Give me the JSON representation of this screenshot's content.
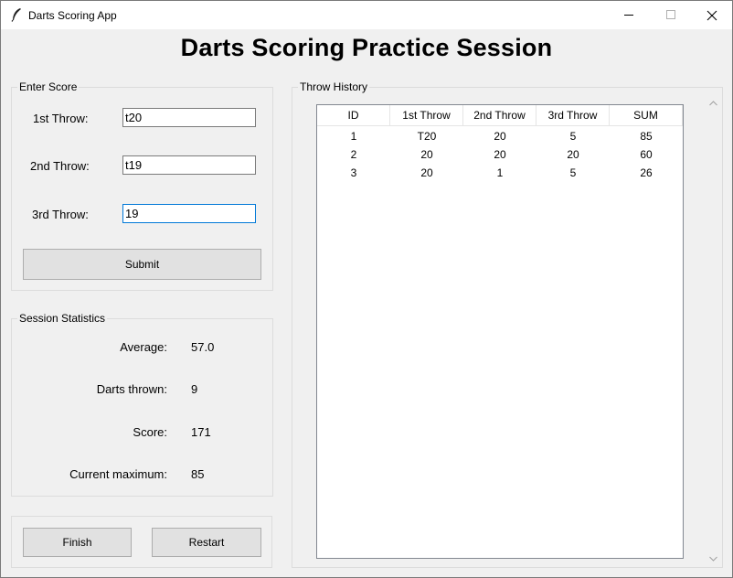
{
  "window": {
    "title": "Darts Scoring App",
    "icon": "feather-icon"
  },
  "page_title": "Darts Scoring Practice Session",
  "enter_score": {
    "legend": "Enter Score",
    "fields": [
      {
        "label": "1st Throw:",
        "value": "t20"
      },
      {
        "label": "2nd Throw:",
        "value": "t19"
      },
      {
        "label": "3rd Throw:",
        "value": "19"
      }
    ],
    "submit_label": "Submit"
  },
  "session_stats": {
    "legend": "Session Statistics",
    "rows": [
      {
        "label": "Average:",
        "value": "57.0"
      },
      {
        "label": "Darts thrown:",
        "value": "9"
      },
      {
        "label": "Score:",
        "value": "171"
      },
      {
        "label": "Current maximum:",
        "value": "85"
      }
    ]
  },
  "actions": {
    "finish_label": "Finish",
    "restart_label": "Restart"
  },
  "history": {
    "legend": "Throw History",
    "columns": [
      "ID",
      "1st Throw",
      "2nd Throw",
      "3rd Throw",
      "SUM"
    ],
    "rows": [
      [
        "1",
        "T20",
        "20",
        "5",
        "85"
      ],
      [
        "2",
        "20",
        "20",
        "20",
        "60"
      ],
      [
        "3",
        "20",
        "1",
        "5",
        "26"
      ]
    ]
  },
  "colors": {
    "window_bg": "#f0f0f0",
    "focus_border": "#0078d7",
    "button_bg": "#e1e1e1"
  }
}
